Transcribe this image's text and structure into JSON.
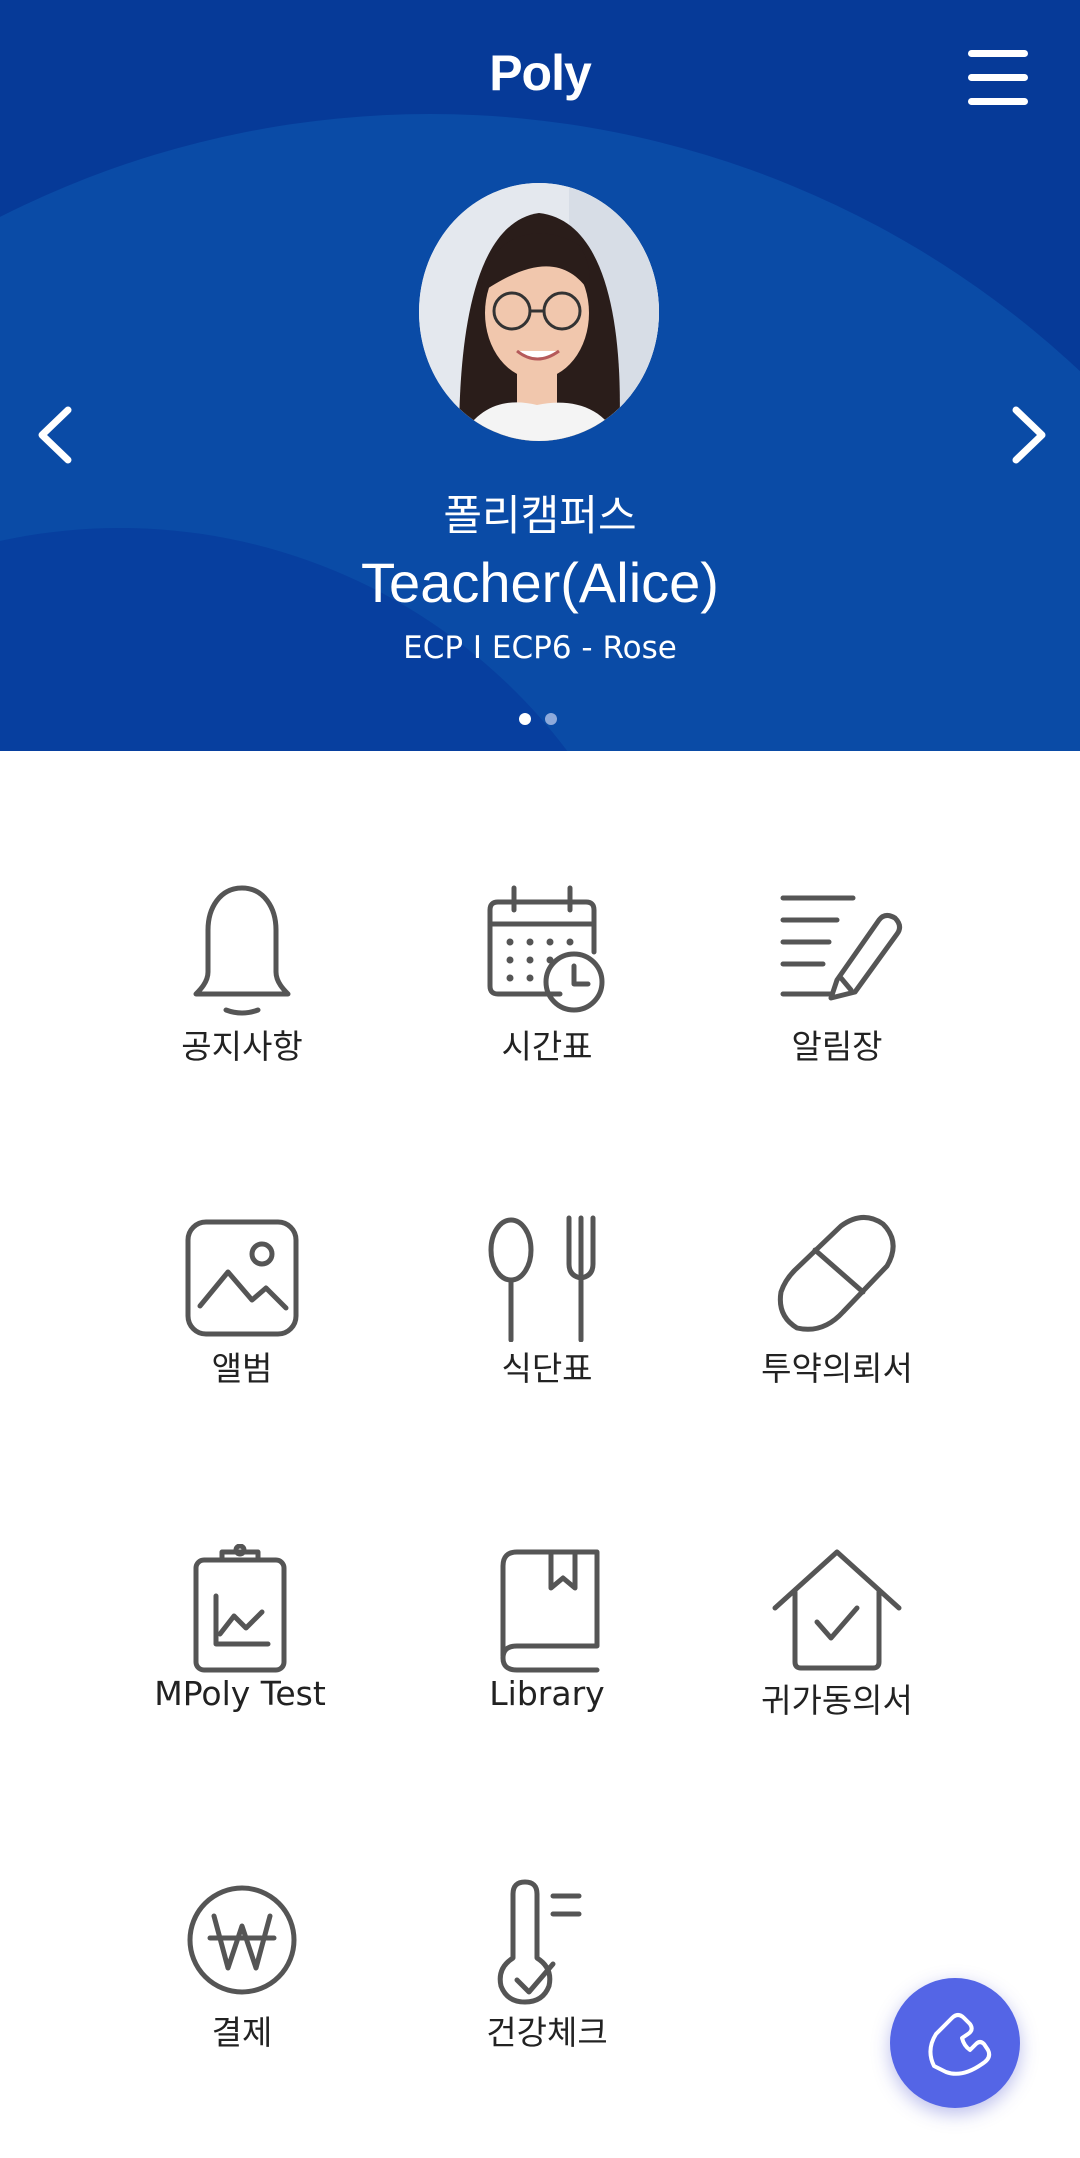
{
  "header": {
    "logo": "Poly",
    "school_name": "폴리캠퍼스",
    "teacher_name": "Teacher(Alice)",
    "class_info": "ECP I ECP6 - Rose",
    "carousel_pages": 2,
    "carousel_active": 1,
    "background_color": "#063a98"
  },
  "menu": [
    {
      "label": "공지사항",
      "icon": "bell-icon"
    },
    {
      "label": "시간표",
      "icon": "calendar-clock-icon"
    },
    {
      "label": "알림장",
      "icon": "note-pencil-icon"
    },
    {
      "label": "앨범",
      "icon": "photo-icon"
    },
    {
      "label": "식단표",
      "icon": "spoon-fork-icon"
    },
    {
      "label": "투약의뢰서",
      "icon": "pill-icon"
    },
    {
      "label": "MPoly Test",
      "icon": "clipboard-chart-icon"
    },
    {
      "label": "Library",
      "icon": "book-icon"
    },
    {
      "label": "귀가동의서",
      "icon": "house-check-icon"
    },
    {
      "label": "결제",
      "icon": "won-coin-icon"
    },
    {
      "label": "건강체크",
      "icon": "thermometer-icon"
    }
  ],
  "fab": {
    "icon": "phone-icon",
    "color": "#5465e6"
  }
}
